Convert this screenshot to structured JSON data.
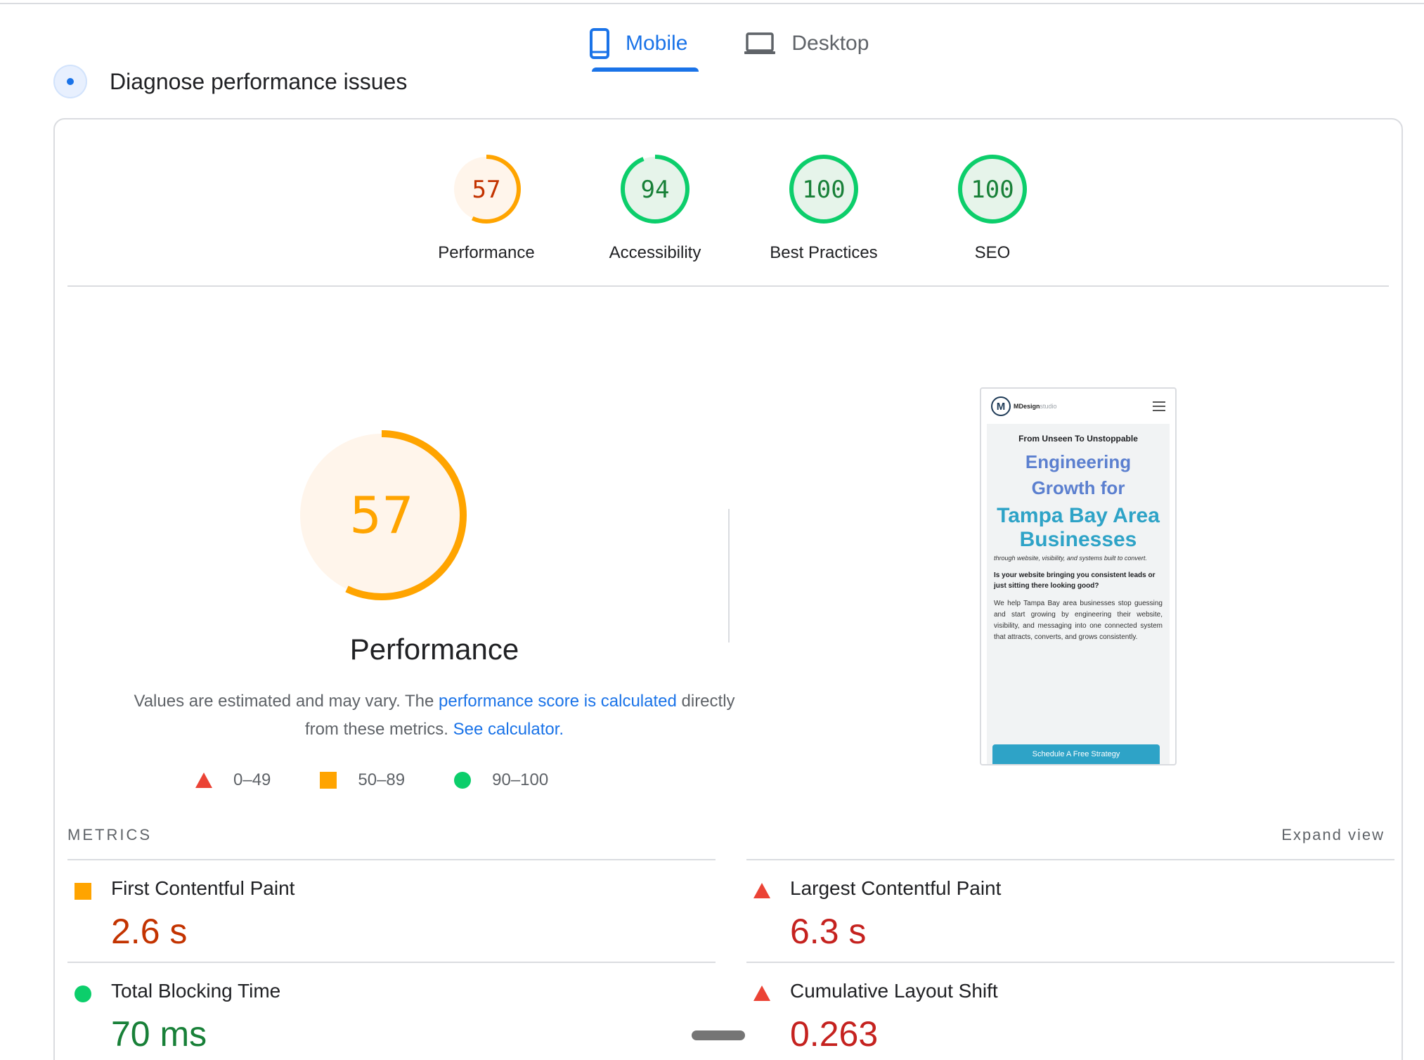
{
  "tabs": [
    {
      "label": "Mobile",
      "active": true,
      "icon": "smartphone-icon"
    },
    {
      "label": "Desktop",
      "active": false,
      "icon": "laptop-icon"
    }
  ],
  "section_title": "Diagnose performance issues",
  "scores": [
    {
      "value": 57,
      "label": "Performance",
      "status": "average"
    },
    {
      "value": 94,
      "label": "Accessibility",
      "status": "pass"
    },
    {
      "value": 100,
      "label": "Best Practices",
      "status": "pass"
    },
    {
      "value": 100,
      "label": "SEO",
      "status": "pass"
    }
  ],
  "main_score": {
    "value": "57",
    "label": "Performance"
  },
  "description": {
    "text_before": "Values are estimated and may vary. The ",
    "link1": "performance score is calculated",
    "text_middle": " directly from these metrics. ",
    "link2": "See calculator."
  },
  "legend": [
    {
      "shape": "triangle",
      "label": "0–49"
    },
    {
      "shape": "square",
      "label": "50–89"
    },
    {
      "shape": "circle",
      "label": "90–100"
    }
  ],
  "screenshot": {
    "logo": "MDesign",
    "logo_suffix": "studio",
    "subtitle": "From Unseen To Unstoppable",
    "heading1": "Engineering Growth for",
    "heading2": "Tampa Bay Area Businesses",
    "italic": "through website, visibility, and systems built to convert.",
    "question": "Is your website bringing you consistent leads or just sitting there looking good?",
    "paragraph": "We help Tampa Bay area businesses stop guessing and start growing by engineering their website, visibility, and messaging into one connected system that attracts, converts, and grows consistently.",
    "button": "Schedule A Free Strategy"
  },
  "metrics_title": "METRICS",
  "expand_label": "Expand view",
  "metrics": [
    {
      "label": "First Contentful Paint",
      "value": "2.6 s",
      "status": "average"
    },
    {
      "label": "Largest Contentful Paint",
      "value": "6.3 s",
      "status": "fail"
    },
    {
      "label": "Total Blocking Time",
      "value": "70 ms",
      "status": "pass"
    },
    {
      "label": "Cumulative Layout Shift",
      "value": "0.263",
      "status": "fail"
    }
  ],
  "colors": {
    "accent": "#1a73e8",
    "average": "#ffa400",
    "average_text": "#c33300",
    "fail": "#eb4335",
    "fail_text": "#c5221f",
    "pass": "#0cce6b",
    "pass_text": "#188038"
  }
}
